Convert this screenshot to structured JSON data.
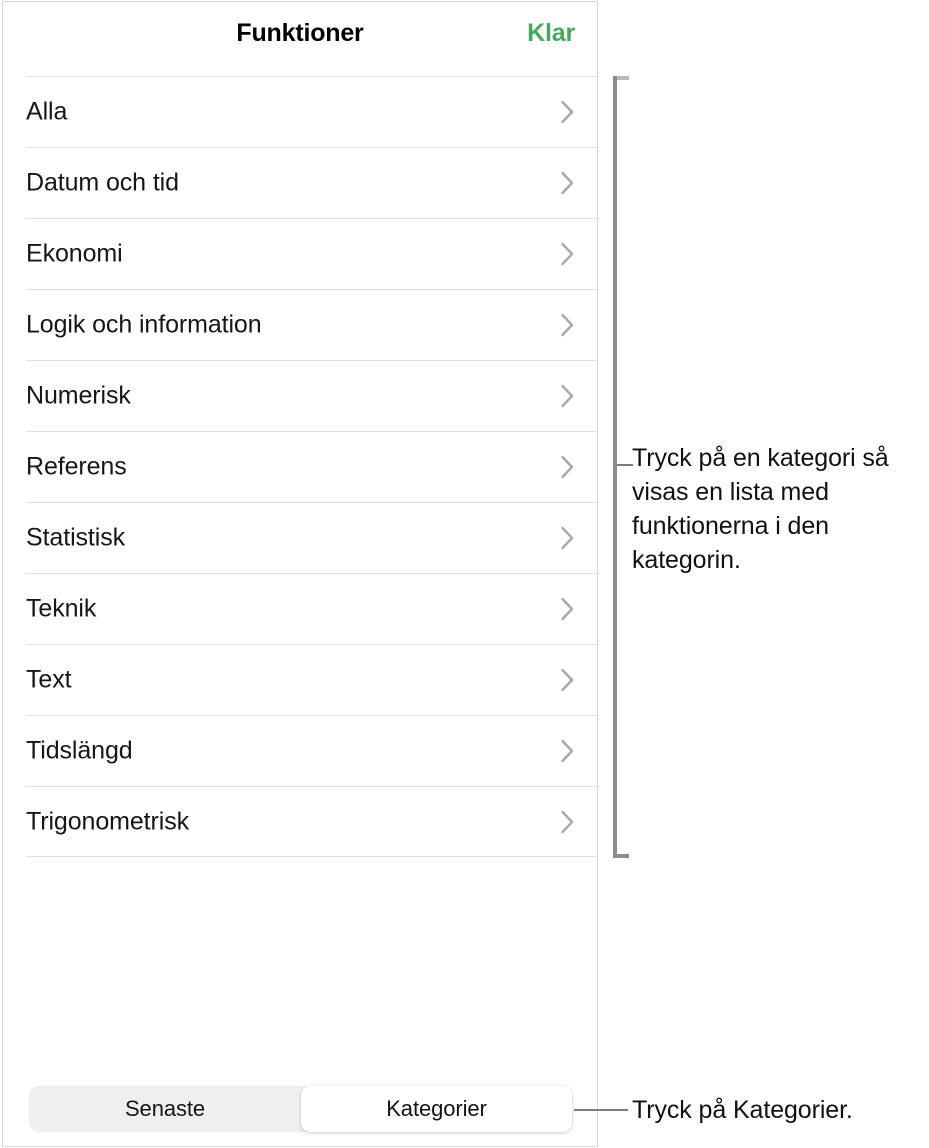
{
  "panel": {
    "header": {
      "title": "Funktioner",
      "done_label": "Klar",
      "done_color": "#4aa85c"
    },
    "categories": [
      {
        "label": "Alla",
        "chevron": "chevron-right-icon"
      },
      {
        "label": "Datum och tid",
        "chevron": "chevron-right-icon"
      },
      {
        "label": "Ekonomi",
        "chevron": "chevron-right-icon"
      },
      {
        "label": "Logik och information",
        "chevron": "chevron-right-icon"
      },
      {
        "label": "Numerisk",
        "chevron": "chevron-right-icon"
      },
      {
        "label": "Referens",
        "chevron": "chevron-right-icon"
      },
      {
        "label": "Statistisk",
        "chevron": "chevron-right-icon"
      },
      {
        "label": "Teknik",
        "chevron": "chevron-right-icon"
      },
      {
        "label": "Text",
        "chevron": "chevron-right-icon"
      },
      {
        "label": "Tidslängd",
        "chevron": "chevron-right-icon"
      },
      {
        "label": "Trigonometrisk",
        "chevron": "chevron-right-icon"
      }
    ],
    "segmented_control": {
      "options": [
        {
          "label": "Senaste",
          "selected": false
        },
        {
          "label": "Kategorier",
          "selected": true
        }
      ],
      "selected_label": "Kategorier"
    }
  },
  "callouts": [
    {
      "id": "list-callout",
      "text": "Tryck på en kategori så visas en lista med funktionerna i den kategorin."
    },
    {
      "id": "segmented-callout",
      "text": "Tryck på Kategorier."
    }
  ]
}
